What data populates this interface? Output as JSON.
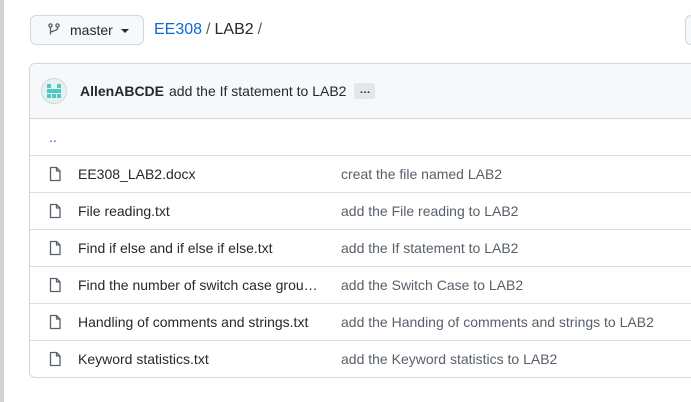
{
  "branch": {
    "label": "master",
    "icon": "git-branch-icon"
  },
  "breadcrumb": {
    "repo": "EE308",
    "separator": "/",
    "folder": "LAB2",
    "trailing": "/"
  },
  "commit": {
    "author": "AllenABCDE",
    "message": "add the If statement to LAB2",
    "ellipsis": "…"
  },
  "parent_dir": "..",
  "files": [
    {
      "name": "EE308_LAB2.docx",
      "message": "creat the file named LAB2"
    },
    {
      "name": "File reading.txt",
      "message": "add the File reading to LAB2"
    },
    {
      "name": "Find if else and if else if else.txt",
      "message": "add the If statement to LAB2"
    },
    {
      "name": "Find the number of switch case group…",
      "message": "add the Switch Case to LAB2"
    },
    {
      "name": "Handling of comments and strings.txt",
      "message": "add the Handing of comments and strings to LAB2"
    },
    {
      "name": "Keyword statistics.txt",
      "message": "add the Keyword statistics to LAB2"
    }
  ],
  "colors": {
    "link": "#0969da",
    "avatar": "#4ec9c4"
  }
}
